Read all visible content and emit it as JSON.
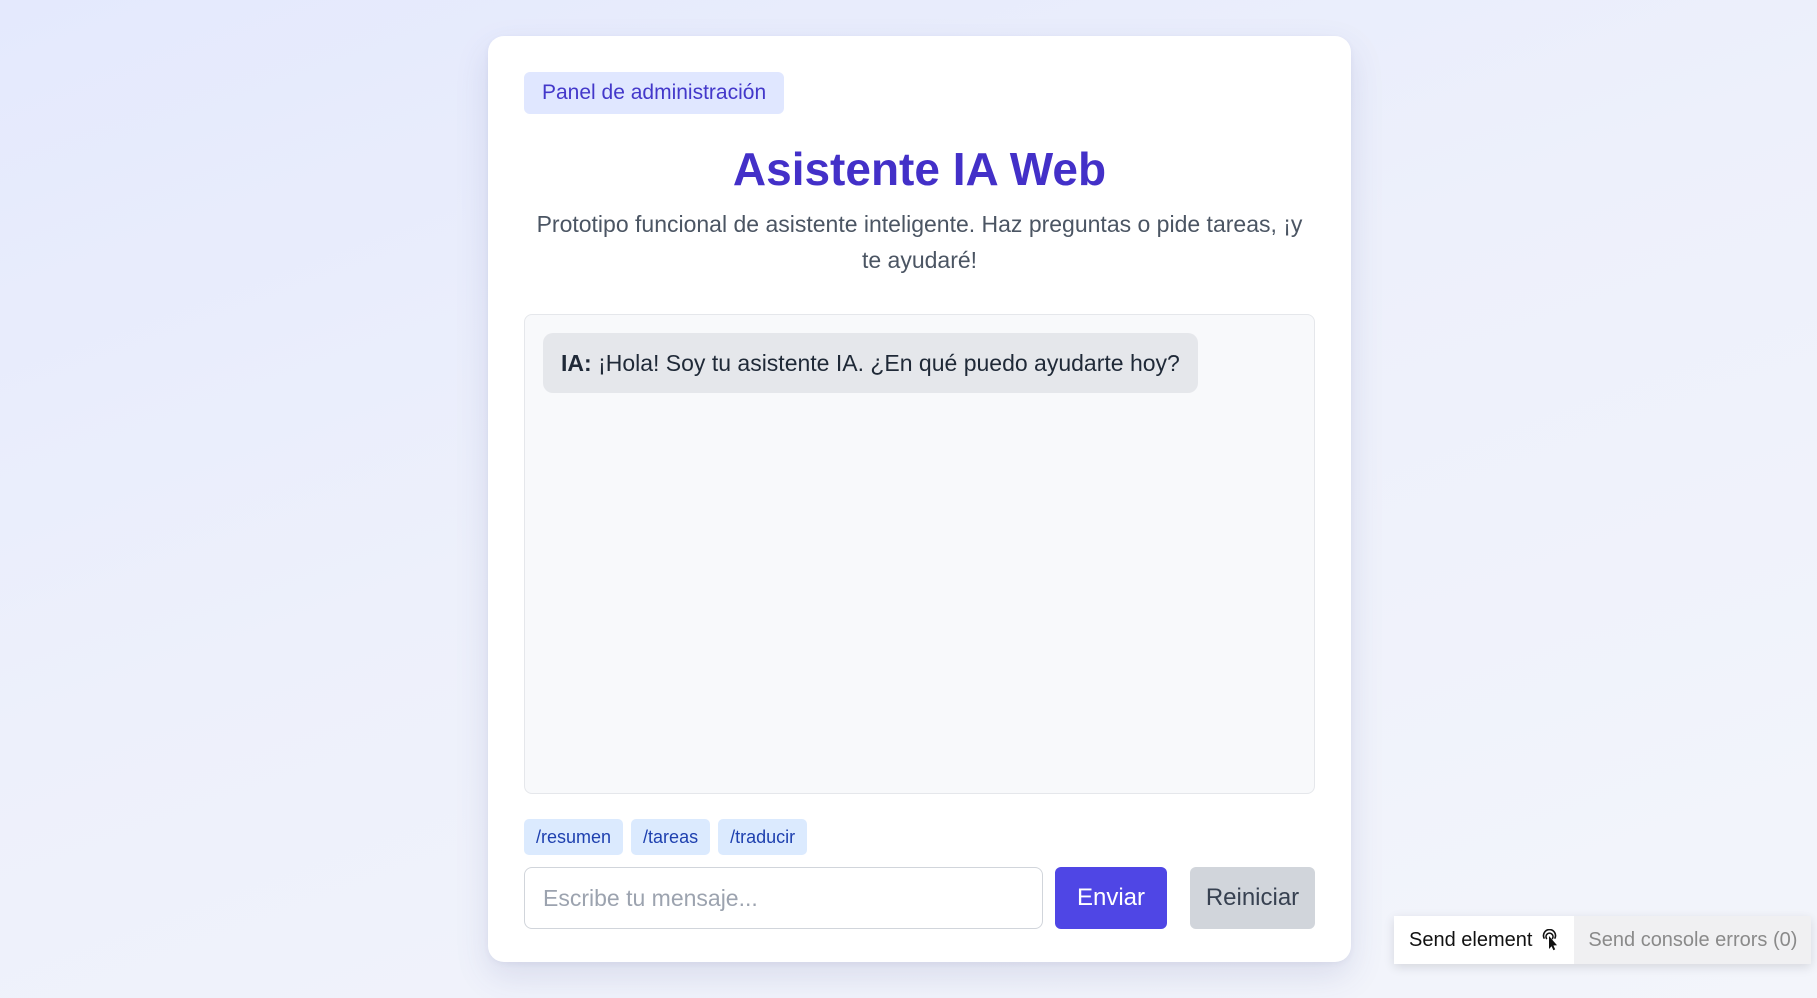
{
  "header": {
    "admin_link": "Panel de administración",
    "title": "Asistente IA Web",
    "subtitle": "Prototipo funcional de asistente inteligente. Haz preguntas o pide tareas, ¡y te ayudaré!"
  },
  "chat": {
    "messages": [
      {
        "sender": "IA:",
        "text": "¡Hola! Soy tu asistente IA. ¿En qué puedo ayudarte hoy?"
      }
    ]
  },
  "shortcuts": [
    "/resumen",
    "/tareas",
    "/traducir"
  ],
  "composer": {
    "placeholder": "Escribe tu mensaje...",
    "value": "",
    "send_label": "Enviar",
    "reset_label": "Reiniciar"
  },
  "devtools": {
    "send_element_label": "Send element",
    "send_element_icon": "pointer-click-icon",
    "send_console_label": "Send console errors (0)"
  },
  "colors": {
    "accent": "#4f46e5",
    "title": "#4330c8",
    "badge_bg": "#e0e7ff",
    "shortcut_bg": "#dbeafe"
  }
}
